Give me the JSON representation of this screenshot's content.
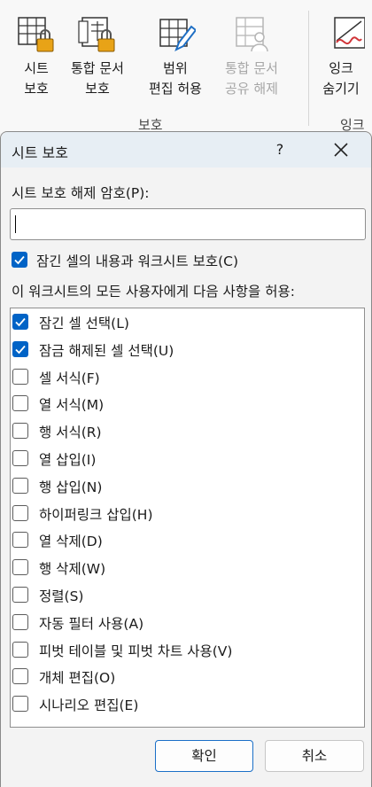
{
  "ribbon": {
    "buttons": [
      {
        "label1": "시트",
        "label2": "보호",
        "icon": "protect-sheet-icon",
        "disabled": false
      },
      {
        "label1": "통합 문서",
        "label2": "보호",
        "icon": "protect-workbook-icon",
        "disabled": false
      },
      {
        "label1": "범위",
        "label2": "편집 허용",
        "icon": "allow-edit-ranges-icon",
        "disabled": false
      },
      {
        "label1": "통합 문서",
        "label2": "공유 해제",
        "icon": "unshare-workbook-icon",
        "disabled": true
      },
      {
        "label1": "잉크",
        "label2": "숨기기",
        "icon": "hide-ink-icon",
        "disabled": false
      }
    ],
    "group_label": "보호",
    "group_label2": "잉크"
  },
  "dialog": {
    "title": "시트 보호",
    "help": "?",
    "password_label": "시트 보호 해제 암호(P):",
    "password_value": "",
    "protect_option": {
      "label": "잠긴 셀의 내용과 워크시트 보호(C)",
      "checked": true
    },
    "allow_label": "이 워크시트의 모든 사용자에게 다음 사항을 허용:",
    "permissions": [
      {
        "label": "잠긴 셀 선택(L)",
        "checked": true
      },
      {
        "label": "잠금 해제된 셀 선택(U)",
        "checked": true
      },
      {
        "label": "셀 서식(F)",
        "checked": false
      },
      {
        "label": "열 서식(M)",
        "checked": false
      },
      {
        "label": "행 서식(R)",
        "checked": false
      },
      {
        "label": "열 삽입(I)",
        "checked": false
      },
      {
        "label": "행 삽입(N)",
        "checked": false
      },
      {
        "label": "하이퍼링크 삽입(H)",
        "checked": false
      },
      {
        "label": "열 삭제(D)",
        "checked": false
      },
      {
        "label": "행 삭제(W)",
        "checked": false
      },
      {
        "label": "정렬(S)",
        "checked": false
      },
      {
        "label": "자동 필터 사용(A)",
        "checked": false
      },
      {
        "label": "피벗 테이블 및 피벗 차트 사용(V)",
        "checked": false
      },
      {
        "label": "개체 편집(O)",
        "checked": false
      },
      {
        "label": "시나리오 편집(E)",
        "checked": false
      }
    ],
    "ok_label": "확인",
    "cancel_label": "취소"
  },
  "colors": {
    "accent": "#0063c6",
    "lock": "#e8a317"
  }
}
